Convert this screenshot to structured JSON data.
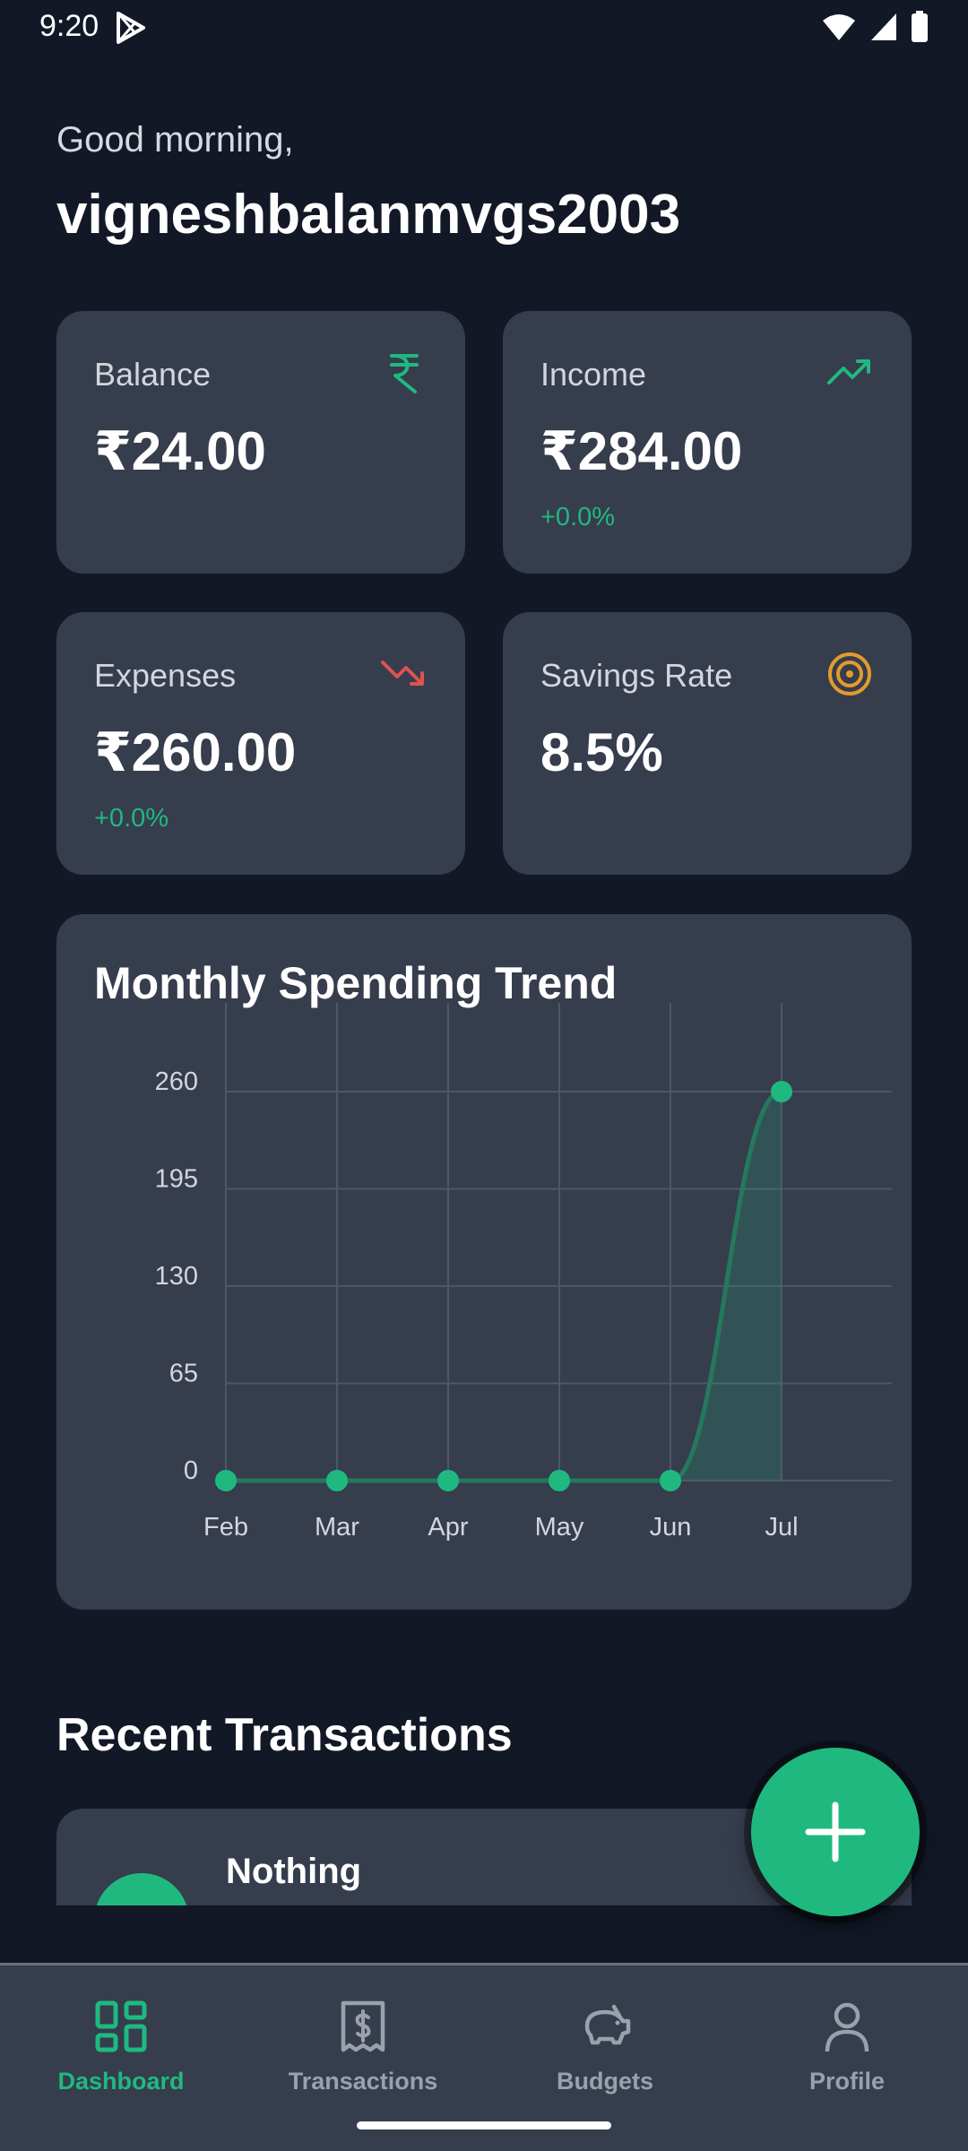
{
  "status_bar": {
    "time": "9:20",
    "icons": [
      "play-store-icon",
      "wifi-icon",
      "cellular-signal-icon",
      "battery-icon"
    ]
  },
  "header": {
    "greeting": "Good morning,",
    "username": "vigneshbalanmvgs2003"
  },
  "stats": {
    "balance": {
      "title": "Balance",
      "value": "₹24.00",
      "icon": "rupee-icon"
    },
    "income": {
      "title": "Income",
      "value": "₹284.00",
      "change": "+0.0%",
      "icon": "trending-up-icon"
    },
    "expenses": {
      "title": "Expenses",
      "value": "₹260.00",
      "change": "+0.0%",
      "icon": "trending-down-icon"
    },
    "savings": {
      "title": "Savings Rate",
      "value": "8.5%",
      "icon": "target-icon"
    }
  },
  "chart_data": {
    "type": "area",
    "title": "Monthly Spending Trend",
    "categories": [
      "Feb",
      "Mar",
      "Apr",
      "May",
      "Jun",
      "Jul"
    ],
    "values": [
      0,
      0,
      0,
      0,
      0,
      260
    ],
    "y_ticks": [
      "0",
      "65",
      "130",
      "195",
      "260"
    ],
    "ylim": [
      0,
      260
    ],
    "grid": true,
    "xlabel": "",
    "ylabel": ""
  },
  "recent": {
    "title": "Recent Transactions",
    "items": [
      {
        "title": "Nothing"
      }
    ]
  },
  "fab": {
    "icon": "plus-icon"
  },
  "bottom_nav": {
    "items": [
      {
        "label": "Dashboard",
        "icon": "dashboard-icon",
        "active": true
      },
      {
        "label": "Transactions",
        "icon": "receipt-icon",
        "active": false
      },
      {
        "label": "Budgets",
        "icon": "piggy-bank-icon",
        "active": false
      },
      {
        "label": "Profile",
        "icon": "user-icon",
        "active": false
      }
    ]
  },
  "colors": {
    "background": "#121826",
    "card": "#363d4d",
    "accent": "#1fb980",
    "expense": "#e0524f",
    "savings": "#e39b2c"
  }
}
